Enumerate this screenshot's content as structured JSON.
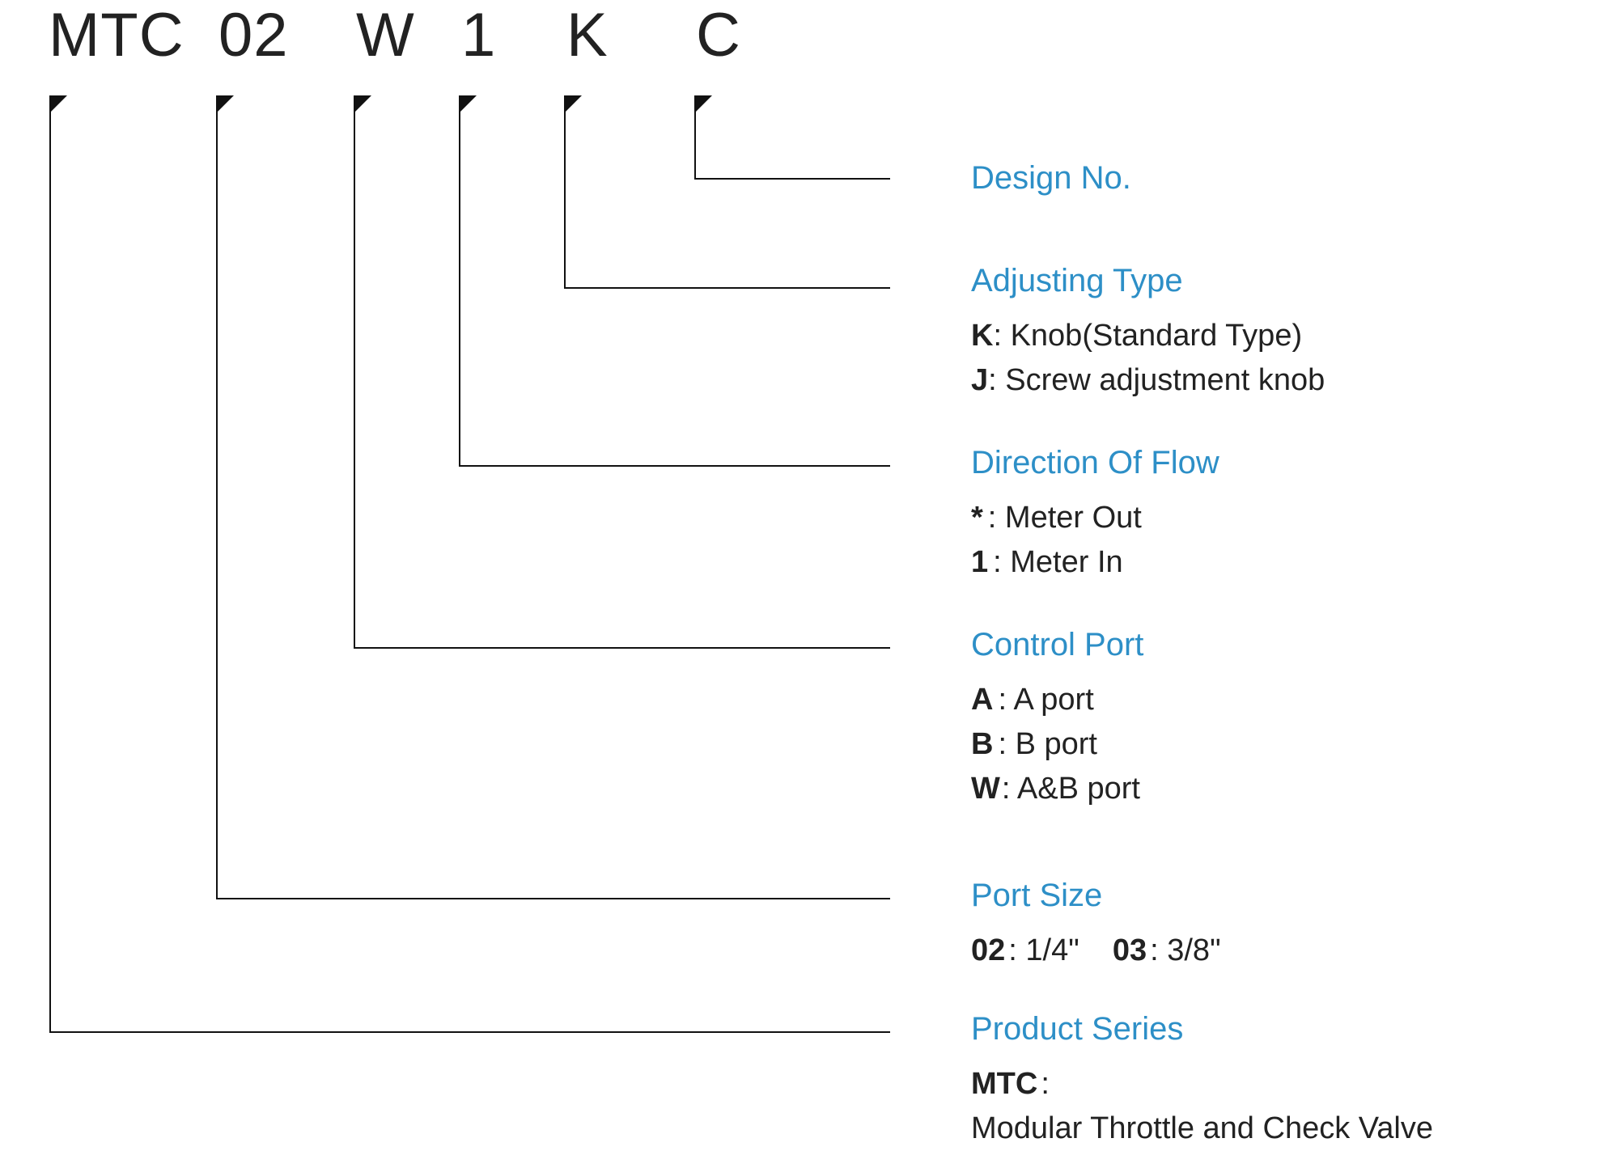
{
  "code_parts": {
    "p1": "MTC",
    "p2": "02",
    "p3": "W",
    "p4": "1",
    "p5": "K",
    "p6": "C"
  },
  "sections": {
    "design_no": {
      "title": "Design No."
    },
    "adjusting_type": {
      "title": "Adjusting Type",
      "opt_k_key": "K",
      "opt_k_val": ": Knob(Standard Type)",
      "opt_j_key": "J",
      "opt_j_val": ": Screw adjustment knob"
    },
    "direction_of_flow": {
      "title": "Direction Of Flow",
      "opt_star_key": "*",
      "opt_star_val": ": Meter Out",
      "opt_1_key": "1",
      "opt_1_val": ": Meter In"
    },
    "control_port": {
      "title": "Control Port",
      "opt_a_key": "A",
      "opt_a_val": ": A port",
      "opt_b_key": "B",
      "opt_b_val": ": B port",
      "opt_w_key": "W",
      "opt_w_val": ": A&B port"
    },
    "port_size": {
      "title": "Port Size",
      "opt_02_key": "02",
      "opt_02_val": ": 1/4\"",
      "opt_03_key": "03",
      "opt_03_val": ": 3/8\""
    },
    "product_series": {
      "title": "Product Series",
      "opt_mtc_key": "MTC",
      "opt_mtc_val": ":",
      "desc": "Modular Throttle and Check Valve"
    }
  }
}
